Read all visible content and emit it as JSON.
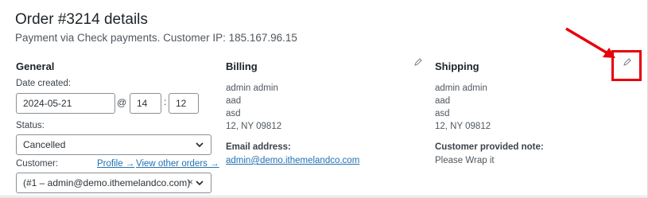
{
  "order": {
    "title": "Order #3214 details",
    "subtitle": "Payment via Check payments. Customer IP: 185.167.96.15"
  },
  "general": {
    "heading": "General",
    "date_label": "Date created:",
    "date_value": "2024-05-21",
    "at_sign": "@",
    "hour_value": "14",
    "colon": ":",
    "minute_value": "12",
    "status_label": "Status:",
    "status_value": "Cancelled",
    "customer_label": "Customer:",
    "profile_link": "Profile →",
    "other_orders_link": "View other orders →",
    "customer_value": "(#1 – admin@demo.ithemelandco.com)",
    "clear_glyph": "×"
  },
  "billing": {
    "heading": "Billing",
    "address_lines": [
      "admin admin",
      "aad",
      "asd",
      "12, NY 09812"
    ],
    "email_label": "Email address:",
    "email_value": "admin@demo.ithemelandco.com"
  },
  "shipping": {
    "heading": "Shipping",
    "address_lines": [
      "admin admin",
      "aad",
      "asd",
      "12, NY 09812"
    ],
    "note_label": "Customer provided note:",
    "note_value": "Please Wrap it"
  },
  "colors": {
    "accent_link": "#2271b1",
    "annotation_red": "#e8000b"
  },
  "icons": {
    "billing_edit": "pencil-icon",
    "shipping_edit": "pencil-icon",
    "select_chevron": "chevron-down-icon"
  }
}
